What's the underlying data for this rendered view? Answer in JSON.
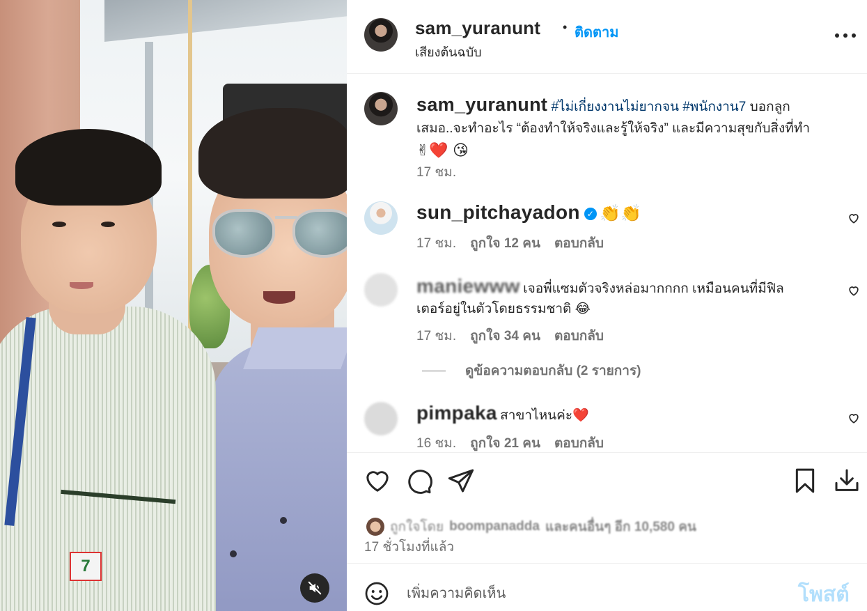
{
  "header": {
    "username": "sam_yuranunt",
    "separator": "•",
    "follow_label": "ติดตาม",
    "audio_label": "เสียงต้นฉบับ"
  },
  "caption": {
    "username": "sam_yuranunt",
    "hashtag1": "#ไม่เกี่ยงงานไม่ยากจน",
    "hashtag2": "#พนักงาน7",
    "text1": " บอกลูก",
    "text2": "เสมอ..จะทำอะไร “ต้องทำให้จริงและรู้ให้จริง” และมีความสุขกับสิ่งที่ทำ",
    "emojis": "✌❤️ 😘",
    "time": "17 ชม."
  },
  "comments": [
    {
      "username": "sun_pitchayadon",
      "verified_mark": "✓",
      "text": "👏👏",
      "time": "17 ชม.",
      "likes": "ถูกใจ 12 คน",
      "reply": "ตอบกลับ"
    },
    {
      "username": "maniewww",
      "text": "เจอพี่แซมตัวจริงหล่อมากกกก เหมือนคนที่มีฟิล",
      "text2": "เตอร์อยู่ในตัวโดยธรรมชาติ 😂",
      "time": "17 ชม.",
      "likes": "ถูกใจ 34 คน",
      "reply": "ตอบกลับ"
    },
    {
      "username": "pimpaka",
      "text": "สาขาไหนค่ะ❤️",
      "time": "16 ชม.",
      "likes": "ถูกใจ 21 คน",
      "reply": "ตอบกลับ"
    }
  ],
  "view_replies": "ดูข้อความตอบกลับ (2 รายการ)",
  "liked_by": {
    "prefix": "ถูกใจโดย",
    "user": "boompanadda",
    "rest": "และคนอื่นๆ อีก 10,580 คน"
  },
  "time_ago": "17 ชั่วโมงที่แล้ว",
  "add_comment": {
    "placeholder": "เพิ่มความคิดเห็น",
    "post_label": "โพสต์"
  },
  "media": {
    "logo_text": "7"
  },
  "icons": {
    "like": "heart-icon",
    "comment": "comment-icon",
    "share": "share-icon",
    "save": "bookmark-icon",
    "download": "download-icon",
    "more": "more-options-icon",
    "mute": "volume-muted-icon",
    "emoji": "emoji-icon"
  },
  "colors": {
    "accent": "#0095f6",
    "hashtag": "#00376b",
    "post_disabled": "#b2dffc",
    "secondary_text": "#737373"
  }
}
